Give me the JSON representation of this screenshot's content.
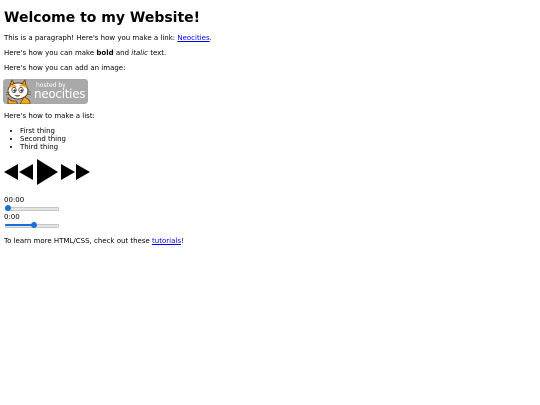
{
  "heading": "Welcome to my Website!",
  "paragraph1": {
    "before": "This is a paragraph! Here's how you make a link: ",
    "link": "Neocities",
    "after": "."
  },
  "paragraph2": {
    "before": "Here's how you can make ",
    "bold": "bold",
    "middle": " and ",
    "italic": "italic",
    "after": " text."
  },
  "paragraph3": "Here's how you can add an image:",
  "badge": {
    "small_text": "hosted by",
    "big_text": "neocities"
  },
  "list_intro": "Here's how to make a list:",
  "list_items": [
    "First thing",
    "Second thing",
    "Third thing"
  ],
  "media_controls": {
    "rewind_icon": "rewind-icon",
    "play_icon": "play-icon",
    "fast_forward_icon": "fast-forward-icon"
  },
  "player1": {
    "time": "00:00",
    "progress": 0.0
  },
  "player2": {
    "time": "0:00",
    "progress": 0.55
  },
  "footer": {
    "before": "To learn more HTML/CSS, check out these ",
    "link": "tutorials",
    "after": "!"
  },
  "colors": {
    "link": "#0000ee",
    "slider_accent": "#1a6ed8",
    "badge_bg": "#a9a9a9"
  }
}
